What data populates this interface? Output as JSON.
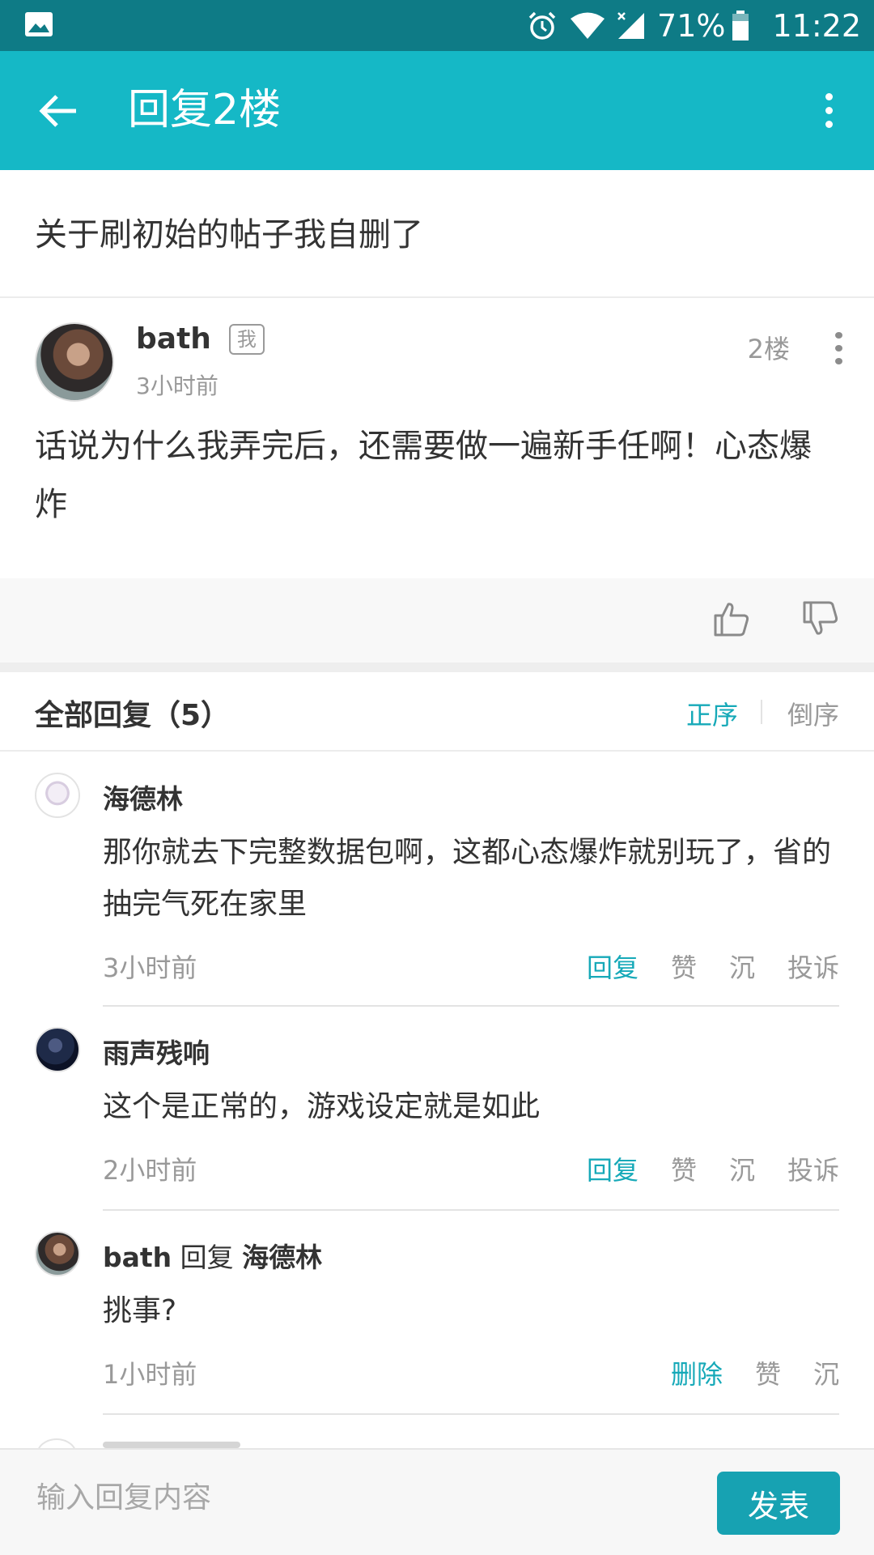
{
  "status_bar": {
    "left_icon": "image-notification-icon",
    "icons": [
      "alarm-icon",
      "wifi-icon",
      "signal-icon"
    ],
    "battery_percent": "71%",
    "time": "11:22"
  },
  "app_bar": {
    "title": "回复2楼",
    "back_icon": "arrow-left-icon",
    "more_icon": "more-vertical-icon"
  },
  "thread": {
    "title": "关于刷初始的帖子我自删了"
  },
  "floor": {
    "username": "bath",
    "badge": "我",
    "time": "3小时前",
    "floor_label": "2楼",
    "content": "话说为什么我弄完后，还需要做一遍新手任啊！心态爆炸"
  },
  "replies_header": {
    "title": "全部回复（5）",
    "sort_asc": "正序",
    "sort_desc": "倒序"
  },
  "replies": [
    {
      "user": "海德林",
      "reply_word": "",
      "reply_to": "",
      "content": "那你就去下完整数据包啊，这都心态爆炸就别玩了，省的抽完气死在家里",
      "time": "3小时前",
      "actions": [
        "回复",
        "赞",
        "沉",
        "投诉"
      ]
    },
    {
      "user": "雨声残响",
      "reply_word": "",
      "reply_to": "",
      "content": "这个是正常的，游戏设定就是如此",
      "time": "2小时前",
      "actions": [
        "回复",
        "赞",
        "沉",
        "投诉"
      ]
    },
    {
      "user": "bath",
      "reply_word": "回复",
      "reply_to": "海德林",
      "content": "挑事?",
      "time": "1小时前",
      "actions": [
        "删除",
        "赞",
        "沉"
      ]
    }
  ],
  "composer": {
    "placeholder": "输入回复内容",
    "send_label": "发表"
  },
  "colors": {
    "status_bar": "#0e7b86",
    "app_bar": "#15b8c6",
    "accent": "#16a9b8",
    "send_button": "#17a2b2"
  }
}
